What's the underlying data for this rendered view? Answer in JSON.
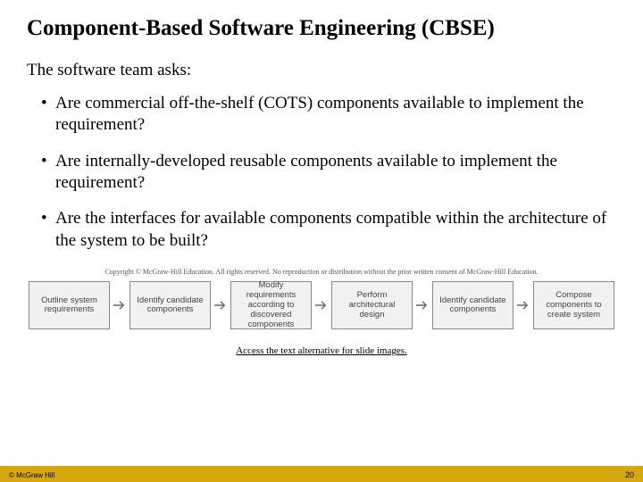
{
  "title": "Component-Based Software Engineering (CBSE)",
  "intro": "The software team asks:",
  "bullets": [
    "Are commercial off-the-shelf (COTS) components available to implement the requirement?",
    "Are internally-developed reusable components available to implement the requirement?",
    "Are the interfaces for available components compatible within the architecture of the system to be built?"
  ],
  "copyright_note": "Copyright © McGraw-Hill Education. All rights reserved. No reproduction or distribution without the prior written consent of McGraw-Hill Education.",
  "flow_boxes": [
    "Outline system requirements",
    "Identify candidate components",
    "Modify requirements according to discovered components",
    "Perform architectural design",
    "Identify candidate components",
    "Compose components to create system"
  ],
  "alt_link": "Access the text alternative for slide images.",
  "footer_left": "© McGraw Hill",
  "footer_right": "20"
}
